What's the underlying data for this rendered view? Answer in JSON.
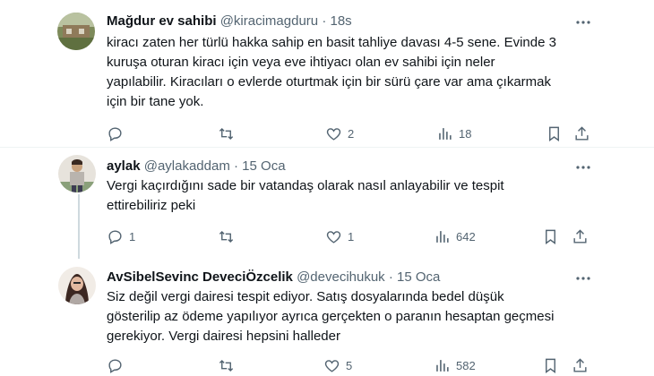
{
  "tweets": [
    {
      "name": "Mağdur ev sahibi",
      "handle": "@kiracimagduru",
      "separator": "·",
      "time": "18s",
      "lines": [
        "kiracı zaten her türlü hakka sahip en basit tahliye davası 4-5 sene. Evinde 3",
        "kuruşa oturan kiracı için veya eve ihtiyacı olan ev sahibi için neler",
        "yapılabilir. Kiracıları o evlerde oturtmak için bir sürü çare var ama çıkarmak",
        "için bir tane yok."
      ],
      "replies": "",
      "retweets": "",
      "likes": "2",
      "views": "18"
    },
    {
      "name": "aylak",
      "handle": "@aylakaddam",
      "separator": "·",
      "time": "15 Oca",
      "lines": [
        "Vergi kaçırdığını sade bir vatandaş olarak nasıl anlayabilir ve tespit",
        "ettirebiliriz peki"
      ],
      "replies": "1",
      "retweets": "",
      "likes": "1",
      "views": "642"
    },
    {
      "name": "AvSibelSevinc DeveciÖzcelik",
      "handle": "@devecihukuk",
      "separator": "·",
      "time": "15 Oca",
      "lines": [
        "Siz değil vergi dairesi tespit ediyor. Satış dosyalarında bedel düşük",
        "gösterilip az ödeme yapılıyor ayrıca gerçekten o paranın hesaptan geçmesi",
        "gerekiyor. Vergi dairesi hepsini halleder"
      ],
      "replies": "",
      "retweets": "",
      "likes": "5",
      "views": "582"
    }
  ],
  "icons": {
    "reply": "reply-icon",
    "retweet": "retweet-icon",
    "like": "heart-icon",
    "views": "views-chart-icon",
    "bookmark": "bookmark-icon",
    "share": "share-icon",
    "more": "more-options-icon"
  },
  "colors": {
    "text": "#0f1419",
    "secondary": "#536471",
    "divider": "#eff3f4",
    "thread": "#cfd9de"
  }
}
